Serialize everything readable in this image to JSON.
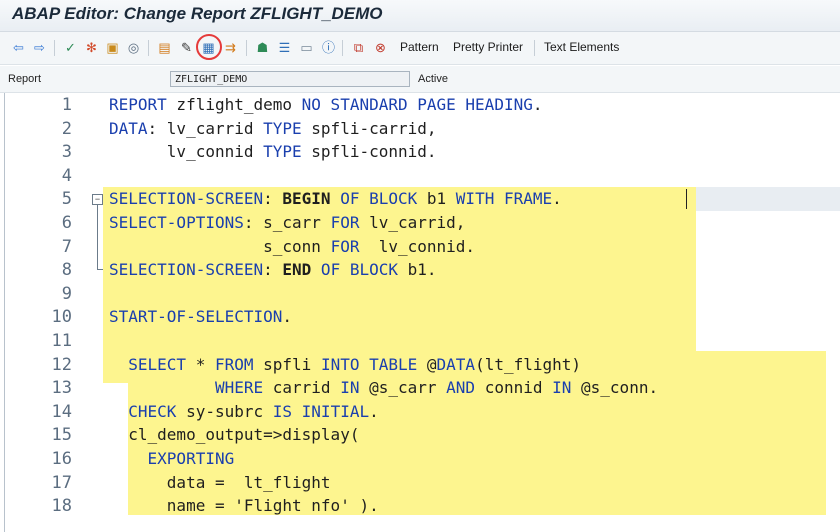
{
  "window": {
    "title": "ABAP Editor: Change Report ZFLIGHT_DEMO"
  },
  "toolbar": {
    "icons": [
      "back-icon",
      "forward-icon",
      "check-icon",
      "activate-icon",
      "test-icon",
      "where-used-icon",
      "object-list-icon",
      "edit-icon",
      "display-change-icon",
      "hierarchy-icon",
      "modules-icon",
      "frame-icon",
      "info-icon",
      "insert-icon",
      "reset-icon"
    ],
    "pattern_label": "Pattern",
    "pretty_printer_label": "Pretty Printer",
    "text_elements_label": "Text Elements"
  },
  "report": {
    "label": "Report",
    "name": "ZFLIGHT_DEMO",
    "status": "Active"
  },
  "editor": {
    "lines": [
      {
        "n": "1",
        "tokens": [
          {
            "t": "REPORT",
            "c": "kw"
          },
          {
            "t": " zflight_demo ",
            "c": ""
          },
          {
            "t": "NO STANDARD PAGE HEADING",
            "c": "kw"
          },
          {
            "t": ".",
            "c": ""
          }
        ]
      },
      {
        "n": "2",
        "tokens": [
          {
            "t": "DATA",
            "c": "kw"
          },
          {
            "t": ": lv_carrid ",
            "c": ""
          },
          {
            "t": "TYPE",
            "c": "kw"
          },
          {
            "t": " spfli-carrid,",
            "c": ""
          }
        ]
      },
      {
        "n": "3",
        "tokens": [
          {
            "t": "      lv_connid ",
            "c": ""
          },
          {
            "t": "TYPE",
            "c": "kw"
          },
          {
            "t": " spfli-connid.",
            "c": ""
          }
        ]
      },
      {
        "n": "4",
        "tokens": []
      },
      {
        "n": "5",
        "tokens": [
          {
            "t": "SELECTION-SCREEN",
            "c": "kw"
          },
          {
            "t": ": ",
            "c": ""
          },
          {
            "t": "BEGIN",
            "c": "bkw"
          },
          {
            "t": " OF BLOCK",
            "c": "dkw"
          },
          {
            "t": " b1 ",
            "c": ""
          },
          {
            "t": "WITH FRAME",
            "c": "dkw"
          },
          {
            "t": ".",
            "c": ""
          }
        ]
      },
      {
        "n": "6",
        "tokens": [
          {
            "t": "SELECT-OPTIONS",
            "c": "kw"
          },
          {
            "t": ": s_carr ",
            "c": ""
          },
          {
            "t": "FOR",
            "c": "kw"
          },
          {
            "t": " lv_carrid,",
            "c": ""
          }
        ]
      },
      {
        "n": "7",
        "tokens": [
          {
            "t": "                s_conn ",
            "c": ""
          },
          {
            "t": "FOR",
            "c": "kw"
          },
          {
            "t": "  lv_connid.",
            "c": ""
          }
        ]
      },
      {
        "n": "8",
        "tokens": [
          {
            "t": "SELECTION-SCREEN",
            "c": "kw"
          },
          {
            "t": ": ",
            "c": ""
          },
          {
            "t": "END",
            "c": "bkw"
          },
          {
            "t": " OF BLOCK",
            "c": "dkw"
          },
          {
            "t": " b1.",
            "c": ""
          }
        ]
      },
      {
        "n": "9",
        "tokens": []
      },
      {
        "n": "10",
        "tokens": [
          {
            "t": "START-OF-SELECTION",
            "c": "kw"
          },
          {
            "t": ".",
            "c": ""
          }
        ]
      },
      {
        "n": "11",
        "tokens": []
      },
      {
        "n": "12",
        "tokens": [
          {
            "t": "  SELECT",
            "c": "kw"
          },
          {
            "t": " * ",
            "c": ""
          },
          {
            "t": "FROM",
            "c": "kw"
          },
          {
            "t": " spfli ",
            "c": ""
          },
          {
            "t": "INTO TABLE",
            "c": "kw"
          },
          {
            "t": " @",
            "c": ""
          },
          {
            "t": "DATA",
            "c": "kw"
          },
          {
            "t": "(lt_flight)",
            "c": ""
          }
        ]
      },
      {
        "n": "13",
        "tokens": [
          {
            "t": "           WHERE",
            "c": "kw"
          },
          {
            "t": " carrid ",
            "c": ""
          },
          {
            "t": "IN",
            "c": "kw"
          },
          {
            "t": " @s_carr ",
            "c": ""
          },
          {
            "t": "AND",
            "c": "kw"
          },
          {
            "t": " connid ",
            "c": ""
          },
          {
            "t": "IN",
            "c": "kw"
          },
          {
            "t": " @s_conn.",
            "c": ""
          }
        ]
      },
      {
        "n": "14",
        "tokens": [
          {
            "t": "  CHECK",
            "c": "kw"
          },
          {
            "t": " sy-subrc ",
            "c": ""
          },
          {
            "t": "IS INITIAL",
            "c": "kw"
          },
          {
            "t": ".",
            "c": ""
          }
        ]
      },
      {
        "n": "15",
        "tokens": [
          {
            "t": "  cl_demo_output=>display(",
            "c": ""
          }
        ]
      },
      {
        "n": "16",
        "tokens": [
          {
            "t": "    EXPORTING",
            "c": "kw"
          }
        ]
      },
      {
        "n": "17",
        "tokens": [
          {
            "t": "      data =  lt_flight",
            "c": ""
          }
        ]
      },
      {
        "n": "18",
        "tokens": [
          {
            "t": "      name = 'Flight nfo' ).",
            "c": ""
          }
        ]
      }
    ]
  },
  "colors": {
    "highlight": "#fdf58f",
    "keyword": "#1a3fae",
    "circle": "#e53a3a"
  }
}
